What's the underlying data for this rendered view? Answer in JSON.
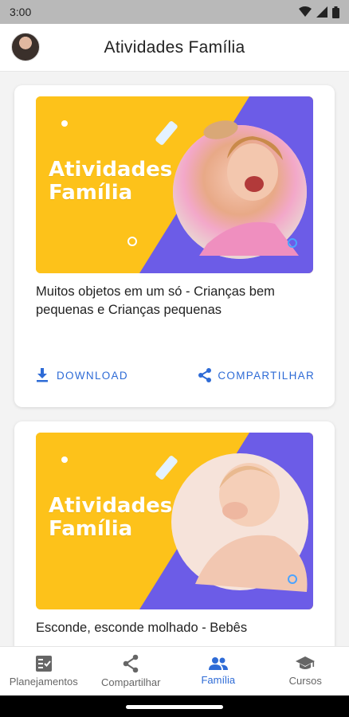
{
  "status_bar": {
    "time": "3:00"
  },
  "header": {
    "title": "Atividades Família"
  },
  "colors": {
    "accent": "#2e6bd6",
    "banner_yellow": "#fdc21a",
    "banner_purple": "#6c5ce7"
  },
  "cards": [
    {
      "banner_title_line1": "Atividades",
      "banner_title_line2": "Família",
      "caption": "Muitos objetos em um só - Crianças bem pequenas e Crianças pequenas",
      "download_label": "DOWNLOAD",
      "share_label": "COMPARTILHAR"
    },
    {
      "banner_title_line1": "Atividades",
      "banner_title_line2": "Família",
      "caption": "Esconde, esconde molhado - Bebês"
    }
  ],
  "bottom_nav": [
    {
      "label": "Planejamentos",
      "icon": "checklist-icon"
    },
    {
      "label": "Compartilhar",
      "icon": "share-icon"
    },
    {
      "label": "Família",
      "icon": "group-icon",
      "active": true
    },
    {
      "label": "Cursos",
      "icon": "graduation-cap-icon"
    }
  ]
}
